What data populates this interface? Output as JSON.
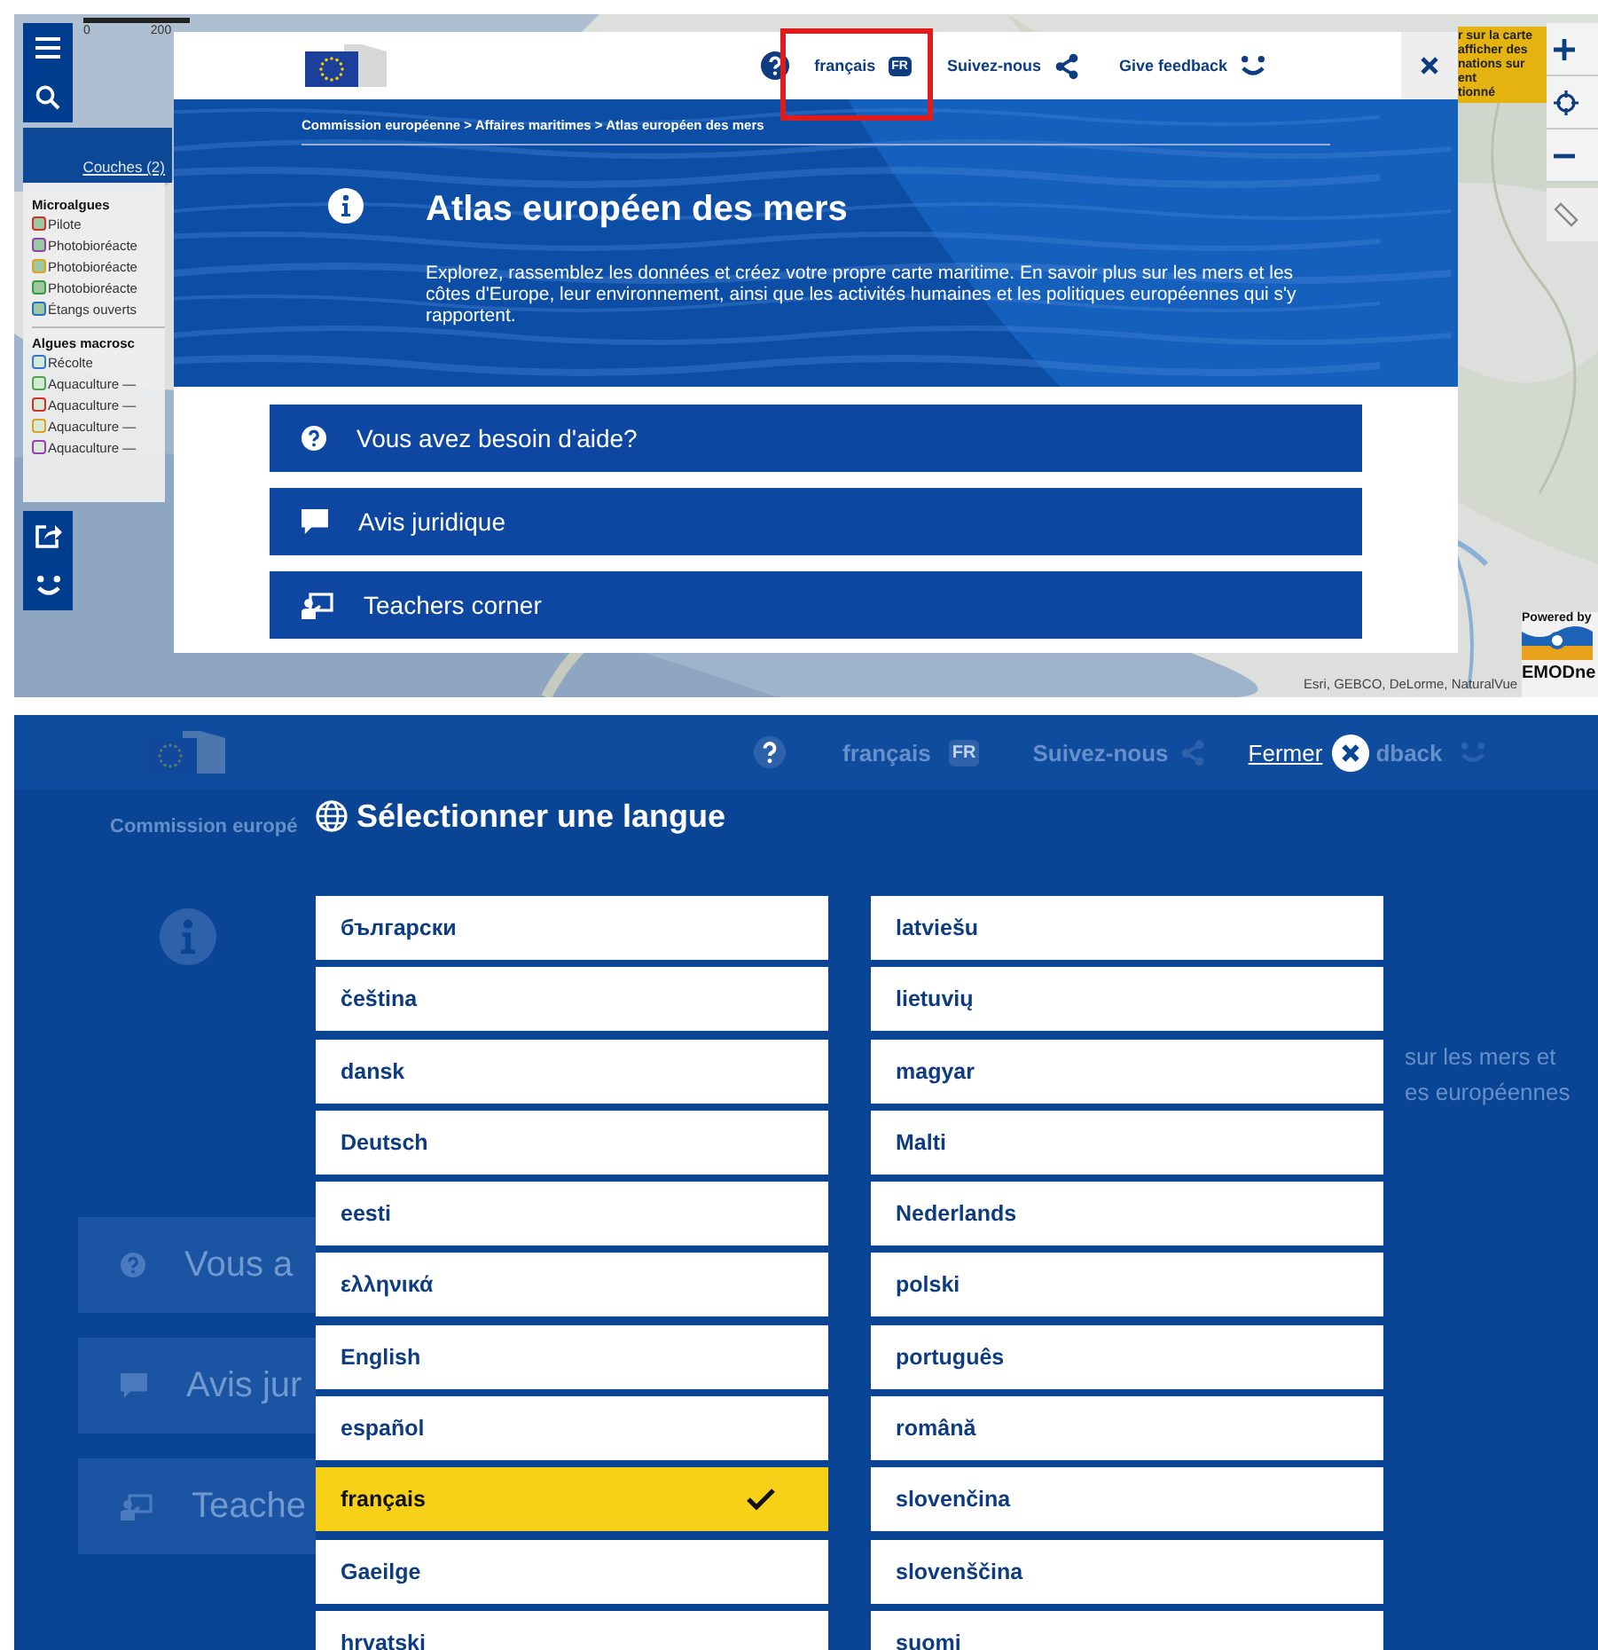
{
  "map_view": {
    "scale_labels": [
      "0",
      "200"
    ],
    "layers_tab": "Couches (2)",
    "legend": [
      {
        "heading": "Microalgues",
        "kind": "microalgae",
        "items": [
          {
            "label": "Pilote",
            "color": "#d0302a"
          },
          {
            "label": "Photobioréacte",
            "color": "#8e44ad"
          },
          {
            "label": "Photobioréacte",
            "color": "#e0a020"
          },
          {
            "label": "Photobioréacte",
            "color": "#3a9a3a"
          },
          {
            "label": "Étangs ouverts",
            "color": "#2a6fc0"
          }
        ]
      },
      {
        "heading": "Algues macrosc",
        "kind": "macroalgae",
        "items": [
          {
            "label": "Récolte",
            "color": "#3a78c8"
          },
          {
            "label": "Aquaculture —",
            "color": "#4aa84a"
          },
          {
            "label": "Aquaculture —",
            "color": "#d0302a"
          },
          {
            "label": "Aquaculture —",
            "color": "#e0a020"
          },
          {
            "label": "Aquaculture —",
            "color": "#9b3fb0"
          }
        ]
      }
    ],
    "tooltip_lines": [
      "r sur la carte",
      "afficher des",
      "nations sur",
      "ent",
      "tionné"
    ],
    "attribution": "Esri, GEBCO, DeLorme, NaturalVue",
    "powered_by": "Powered by",
    "logo_text": "EMODne"
  },
  "info_dialog": {
    "header": {
      "language": "français",
      "language_code": "FR",
      "language_highlighted": true,
      "follow": "Suivez-nous",
      "feedback": "Give feedback"
    },
    "breadcrumb": "Commission européenne > Affaires maritimes > Atlas européen des mers",
    "title": "Atlas européen des mers",
    "description": "Explorez, rassemblez les données et créez votre propre carte maritime. En savoir plus sur les mers et les côtes d'Europe, leur environnement, ainsi que les activités humaines et les politiques européennes qui s'y rapportent.",
    "links": [
      {
        "label": "Vous avez besoin d'aide?",
        "kind": "help"
      },
      {
        "label": "Avis juridique",
        "kind": "legal"
      },
      {
        "label": "Teachers corner",
        "kind": "teachers"
      }
    ]
  },
  "language_dialog": {
    "background": {
      "language": "français",
      "language_code": "FR",
      "follow": "Suivez-nous",
      "feedback_fragment": "dback",
      "breadcrumb_fragment": "Commission europé",
      "description_fragments": [
        "sur les mers et",
        "es européennes"
      ],
      "link_fragments": [
        {
          "label": "Vous a",
          "kind": "help"
        },
        {
          "label": "Avis jur",
          "kind": "legal"
        },
        {
          "label": "Teache",
          "kind": "teachers"
        }
      ]
    },
    "close_label": "Fermer",
    "title": "Sélectionner une langue",
    "languages": [
      {
        "label": "български",
        "selected": false
      },
      {
        "label": "čeština",
        "selected": false
      },
      {
        "label": "dansk",
        "selected": false
      },
      {
        "label": "Deutsch",
        "selected": false
      },
      {
        "label": "eesti",
        "selected": false
      },
      {
        "label": "ελληνικά",
        "selected": false
      },
      {
        "label": "English",
        "selected": false
      },
      {
        "label": "español",
        "selected": false
      },
      {
        "label": "français",
        "selected": true
      },
      {
        "label": "Gaeilge",
        "selected": false
      },
      {
        "label": "hrvatski",
        "selected": false
      },
      {
        "label": "latviešu",
        "selected": false
      },
      {
        "label": "lietuvių",
        "selected": false
      },
      {
        "label": "magyar",
        "selected": false
      },
      {
        "label": "Malti",
        "selected": false
      },
      {
        "label": "Nederlands",
        "selected": false
      },
      {
        "label": "polski",
        "selected": false
      },
      {
        "label": "português",
        "selected": false
      },
      {
        "label": "română",
        "selected": false
      },
      {
        "label": "slovenčina",
        "selected": false
      },
      {
        "label": "slovenščina",
        "selected": false
      },
      {
        "label": "suomi",
        "selected": false
      }
    ]
  }
}
